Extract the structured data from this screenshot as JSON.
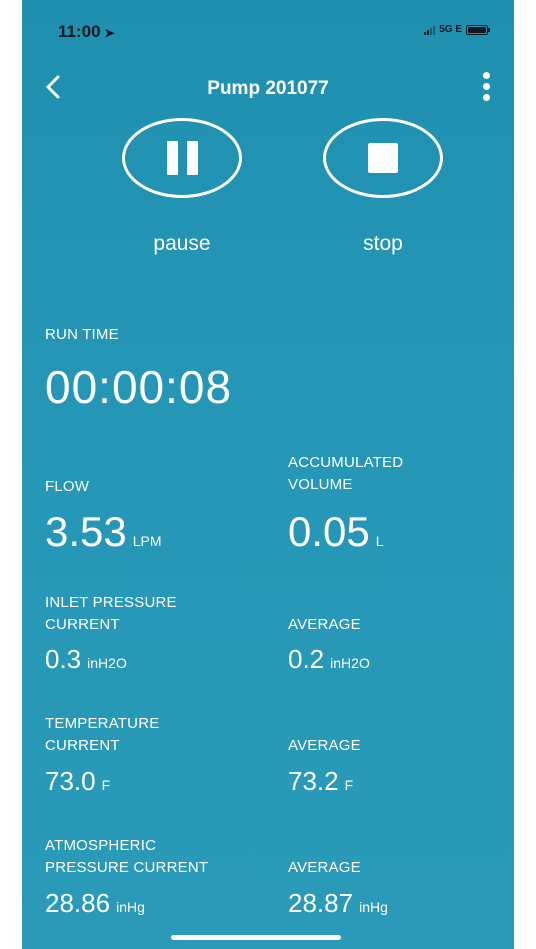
{
  "status_bar": {
    "time": "11:00",
    "location_arrow": "➤",
    "network": "5G E"
  },
  "nav": {
    "title": "Pump 201077"
  },
  "controls": {
    "pause_label": "pause",
    "stop_label": "stop"
  },
  "run_time": {
    "label": "RUN TIME",
    "value": "00:00:08"
  },
  "flow": {
    "label": "FLOW",
    "value": "3.53",
    "unit": "LPM"
  },
  "accumulated_volume": {
    "label_line1": "ACCUMULATED",
    "label_line2": "VOLUME",
    "value": "0.05",
    "unit": "L"
  },
  "inlet_pressure": {
    "label_line1": "INLET PRESSURE",
    "label_line2": "CURRENT",
    "value": "0.3",
    "unit": "inH2O",
    "average_label": "AVERAGE",
    "average_value": "0.2",
    "average_unit": "inH2O"
  },
  "temperature": {
    "label_line1": "TEMPERATURE",
    "label_line2": "CURRENT",
    "value": "73.0",
    "unit": "F",
    "average_label": "AVERAGE",
    "average_value": "73.2",
    "average_unit": "F"
  },
  "atmospheric_pressure": {
    "label_line1": "ATMOSPHERIC",
    "label_line2": "PRESSURE CURRENT",
    "value": "28.86",
    "unit": "inHg",
    "average_label": "AVERAGE",
    "average_value": "28.87",
    "average_unit": "inHg"
  }
}
